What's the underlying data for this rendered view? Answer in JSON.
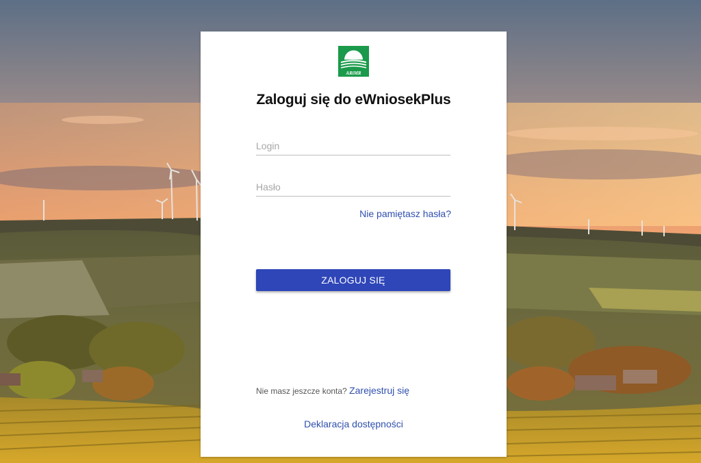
{
  "app": {
    "title": "Zaloguj się do eWniosekPlus",
    "logo_text": "ARiMR",
    "brand_color": "#1a9a4a"
  },
  "form": {
    "login_placeholder": "Login",
    "login_value": "",
    "password_placeholder": "Hasło",
    "password_value": "",
    "forgot_label": "Nie pamiętasz hasła?",
    "submit_label": "ZALOGUJ SIĘ",
    "submit_color": "#2f46b8"
  },
  "footer": {
    "no_account_text": "Nie masz jeszcze konta?",
    "register_label": "Zarejestruj się",
    "accessibility_label": "Deklaracja dostępności",
    "link_color": "#2f4fad"
  }
}
